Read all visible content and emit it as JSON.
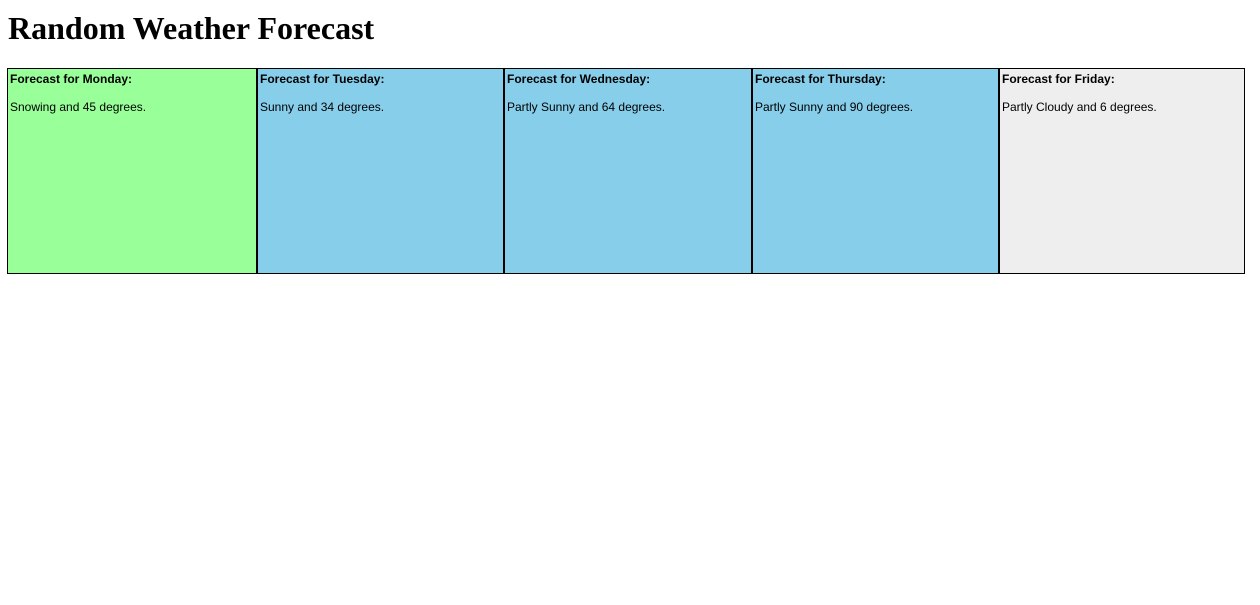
{
  "page": {
    "title": "Random Weather Forecast"
  },
  "days": [
    {
      "title": "Forecast for Monday:",
      "description": "Snowing and 45 degrees.",
      "color": "#99ff99"
    },
    {
      "title": "Forecast for Tuesday:",
      "description": "Sunny and 34 degrees.",
      "color": "#87ceeb"
    },
    {
      "title": "Forecast for Wednesday:",
      "description": "Partly Sunny and 64 degrees.",
      "color": "#87ceeb"
    },
    {
      "title": "Forecast for Thursday:",
      "description": "Partly Sunny and 90 degrees.",
      "color": "#87ceeb"
    },
    {
      "title": "Forecast for Friday:",
      "description": "Partly Cloudy and 6 degrees.",
      "color": "#eeeeee"
    }
  ]
}
